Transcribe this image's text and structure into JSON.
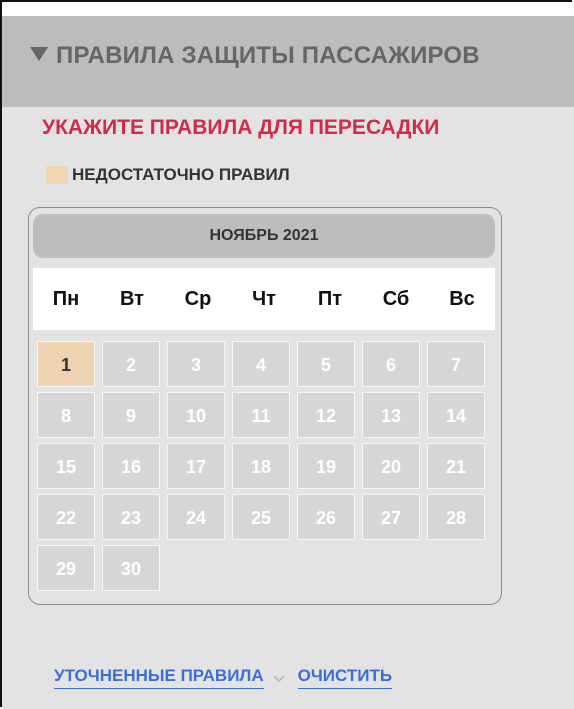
{
  "panel": {
    "title": "ПРАВИЛА ЗАЩИТЫ ПАССАЖИРОВ",
    "warning": "УКАЖИТЕ ПРАВИЛА ДЛЯ ПЕРЕСАДКИ",
    "legend_label": "НЕДОСТАТОЧНО ПРАВИЛ"
  },
  "calendar": {
    "month_title": "НОЯБРЬ 2021",
    "weekdays": [
      "Пн",
      "Вт",
      "Ср",
      "Чт",
      "Пт",
      "Сб",
      "Вс"
    ],
    "days": [
      "1",
      "2",
      "3",
      "4",
      "5",
      "6",
      "7",
      "8",
      "9",
      "10",
      "11",
      "12",
      "13",
      "14",
      "15",
      "16",
      "17",
      "18",
      "19",
      "20",
      "21",
      "22",
      "23",
      "24",
      "25",
      "26",
      "27",
      "28",
      "29",
      "30"
    ],
    "selected_day": "1"
  },
  "footer": {
    "refined_rules_label": "УТОЧНЕННЫЕ ПРАВИЛА",
    "clear_label": "ОЧИСТИТЬ"
  },
  "colors": {
    "header_bg": "#bcbcbc",
    "warning": "#d22b48",
    "selected_day": "#efd2b2",
    "link": "#3b6fd6"
  }
}
